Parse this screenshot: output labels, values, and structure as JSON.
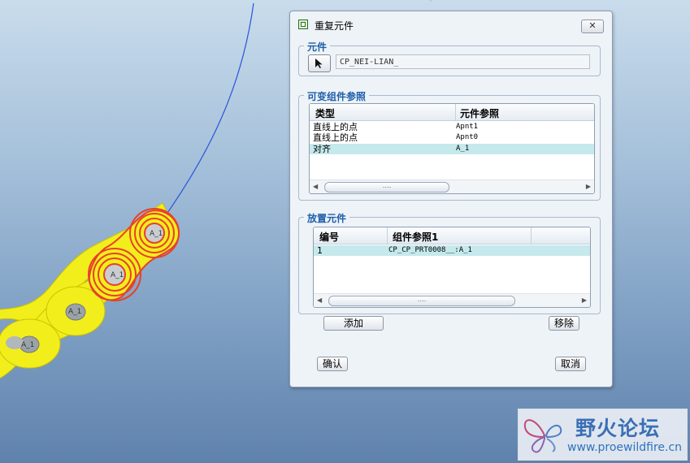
{
  "dialog": {
    "title": "重复元件",
    "close_label": "✕",
    "component_group": {
      "legend": "元件",
      "value": "CP_NEI-LIAN_"
    },
    "variable_refs": {
      "legend": "可变组件参照",
      "headers": [
        "类型",
        "元件参照"
      ],
      "rows": [
        {
          "type": "直线上的点",
          "ref": "Apnt1"
        },
        {
          "type": "直线上的点",
          "ref": "Apnt0"
        },
        {
          "type": "对齐",
          "ref": "A_1"
        }
      ],
      "selected_row": 2,
      "scroll_grip": "…."
    },
    "placement": {
      "legend": "放置元件",
      "headers": [
        "编号",
        "组件参照1"
      ],
      "rows": [
        {
          "num": "1",
          "ref": "CP_CP_PRT0008__:A_1"
        }
      ],
      "scroll_grip": "…."
    },
    "add_label": "添加",
    "remove_label": "移除",
    "ok_label": "确认",
    "cancel_label": "取消"
  },
  "viewport": {
    "axis_labels": [
      "A_1",
      "A_1",
      "A_1",
      "A_1"
    ]
  },
  "watermark": {
    "title": "野火论坛",
    "url": "www.proewildfire.cn"
  },
  "colors": {
    "accent": "#1d5ea8",
    "selected_row": "#c5e9ec",
    "chain": "#f2ee1c",
    "highlight": "#e8402a"
  }
}
